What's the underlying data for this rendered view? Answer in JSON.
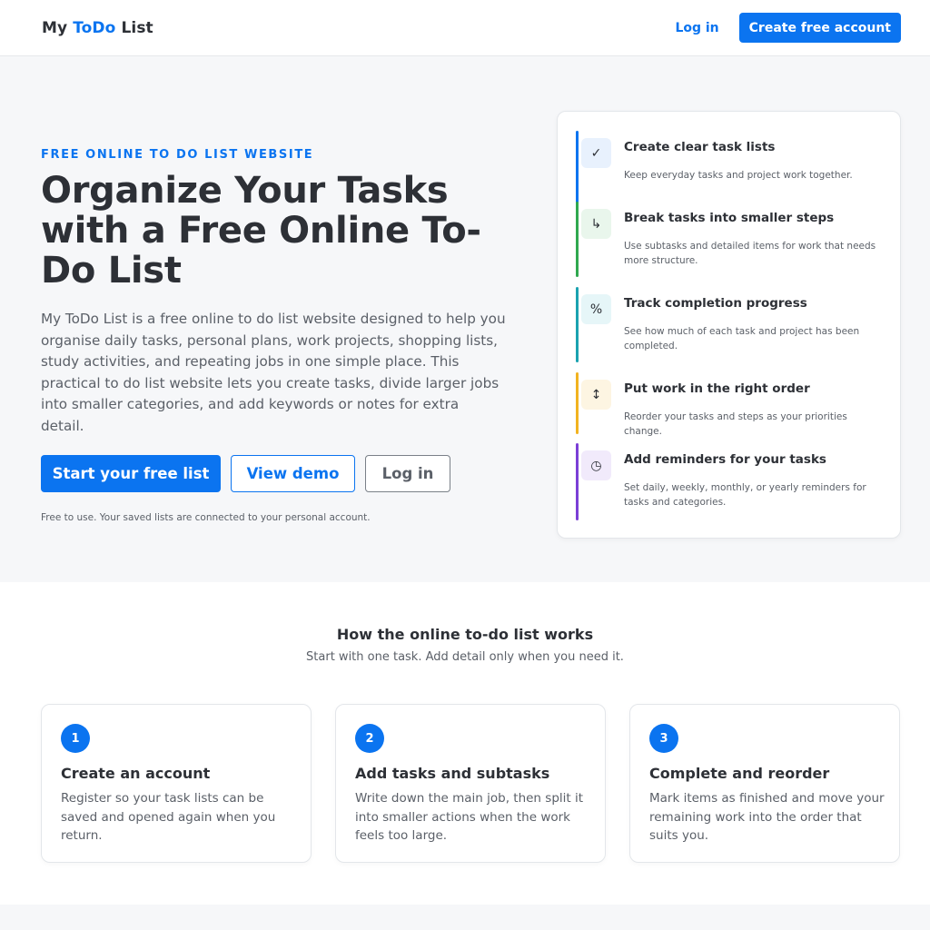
{
  "header": {
    "logo_part1": "My ",
    "logo_accent": "ToDo",
    "logo_part2": " List",
    "login_label": "Log in",
    "create_account_label": "Create free account"
  },
  "hero": {
    "eyebrow": "FREE ONLINE TO DO LIST WEBSITE",
    "title": "Organize Your Tasks with a Free Online To-Do List",
    "description": "My ToDo List is a free online to do list website designed to help you organise daily tasks, personal plans, work projects, shopping lists, study activities, and repeating jobs in one simple place. This practical to do list website lets you create tasks, divide larger jobs into smaller categories, and add keywords or notes for extra detail.",
    "primary_button": "Start your free list",
    "demo_button": "View demo",
    "login_button": "Log in",
    "note": "Free to use. Your saved lists are connected to your personal account."
  },
  "features": [
    {
      "icon": "check-icon",
      "glyph": "✓",
      "color": "#0b74f0",
      "bg": "#e8f1fd",
      "title": "Create clear task lists",
      "desc": "Keep everyday tasks and project work together."
    },
    {
      "icon": "subtask-arrow-icon",
      "glyph": "↳",
      "color": "#2fa84f",
      "bg": "#e9f6ec",
      "title": "Break tasks into smaller steps",
      "desc": "Use subtasks and detailed items for work that needs more structure."
    },
    {
      "icon": "percent-icon",
      "glyph": "%",
      "color": "#1aa2b0",
      "bg": "#e6f6f8",
      "title": "Track completion progress",
      "desc": "See how much of each task and project has been completed."
    },
    {
      "icon": "reorder-arrows-icon",
      "glyph": "↕",
      "color": "#f2b320",
      "bg": "#fdf5e2",
      "title": "Put work in the right order",
      "desc": "Reorder your tasks and steps as your priorities change."
    },
    {
      "icon": "clock-icon",
      "glyph": "◷",
      "color": "#7b3fd6",
      "bg": "#f1eafb",
      "title": "Add reminders for your tasks",
      "desc": "Set daily, weekly, monthly, or yearly reminders for tasks and categories."
    }
  ],
  "how": {
    "title": "How the online to-do list works",
    "subtitle": "Start with one task. Add detail only when you need it.",
    "steps": [
      {
        "number": "1",
        "title": "Create an account",
        "desc": "Register so your task lists can be saved and opened again when you return."
      },
      {
        "number": "2",
        "title": "Add tasks and subtasks",
        "desc": "Write down the main job, then split it into smaller actions when the work feels too large."
      },
      {
        "number": "3",
        "title": "Complete and reorder",
        "desc": "Mark items as finished and move your remaining work into the order that suits you."
      }
    ]
  }
}
